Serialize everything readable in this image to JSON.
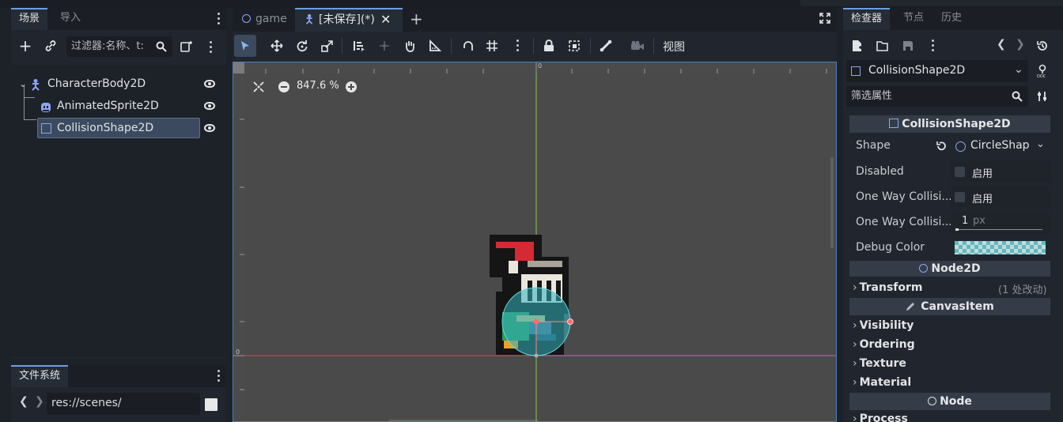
{
  "scene_dock": {
    "tabs": [
      "场景",
      "导入"
    ],
    "filter_placeholder": "过滤器:名称、t:",
    "nodes": [
      {
        "name": "CharacterBody2D",
        "icon": "character-body-icon"
      },
      {
        "name": "AnimatedSprite2D",
        "icon": "animated-sprite-icon"
      },
      {
        "name": "CollisionShape2D",
        "icon": "collision-shape-icon",
        "selected": true
      }
    ]
  },
  "filesystem_dock": {
    "tab": "文件系统",
    "path": "res://scenes/"
  },
  "editor": {
    "tabs": [
      {
        "label": "game",
        "active": false
      },
      {
        "label": "[未保存](*)",
        "active": true
      }
    ],
    "view_menu": "视图",
    "zoom": "847.6 %",
    "ruler_zero": "0"
  },
  "inspector": {
    "tabs": [
      "检查器",
      "节点",
      "历史"
    ],
    "object_name": "CollisionShape2D",
    "filter_placeholder": "筛选属性",
    "class_header": "CollisionShape2D",
    "properties": {
      "shape_label": "Shape",
      "shape_value": "CircleShap",
      "disabled_label": "Disabled",
      "disabled_value": "启用",
      "one_way_label": "One Way Collisi...",
      "one_way_value": "启用",
      "one_way_margin_label": "One Way Collisi...",
      "one_way_margin_value": "1",
      "one_way_margin_unit": "px",
      "debug_color_label": "Debug Color",
      "debug_color": "#66c9d0"
    },
    "node2d_header": "Node2D",
    "transform_label": "Transform",
    "transform_changes": "(1 处改动)",
    "canvasitem_header": "CanvasItem",
    "canvasitem_groups": [
      "Visibility",
      "Ordering",
      "Texture",
      "Material"
    ],
    "node_header": "Node",
    "process_label": "Process"
  },
  "colors": {
    "accent": "#6aa0e0",
    "selection": "#3b4a5e",
    "viewport_bg": "#4a4a4a"
  }
}
